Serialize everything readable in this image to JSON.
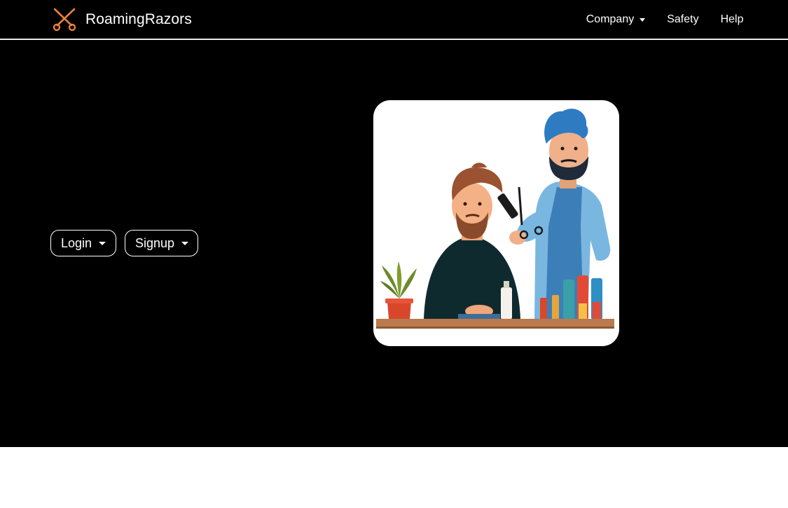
{
  "header": {
    "brand_name": "RoamingRazors",
    "brand_icon": "scissors-icon",
    "nav": [
      {
        "label": "Company",
        "has_dropdown": true
      },
      {
        "label": "Safety",
        "has_dropdown": false
      },
      {
        "label": "Help",
        "has_dropdown": false
      }
    ]
  },
  "hero": {
    "login_label": "Login",
    "signup_label": "Signup",
    "illustration": "barber-illustration"
  },
  "colors": {
    "background": "#000000",
    "accent": "#e8813a",
    "text": "#ffffff"
  }
}
